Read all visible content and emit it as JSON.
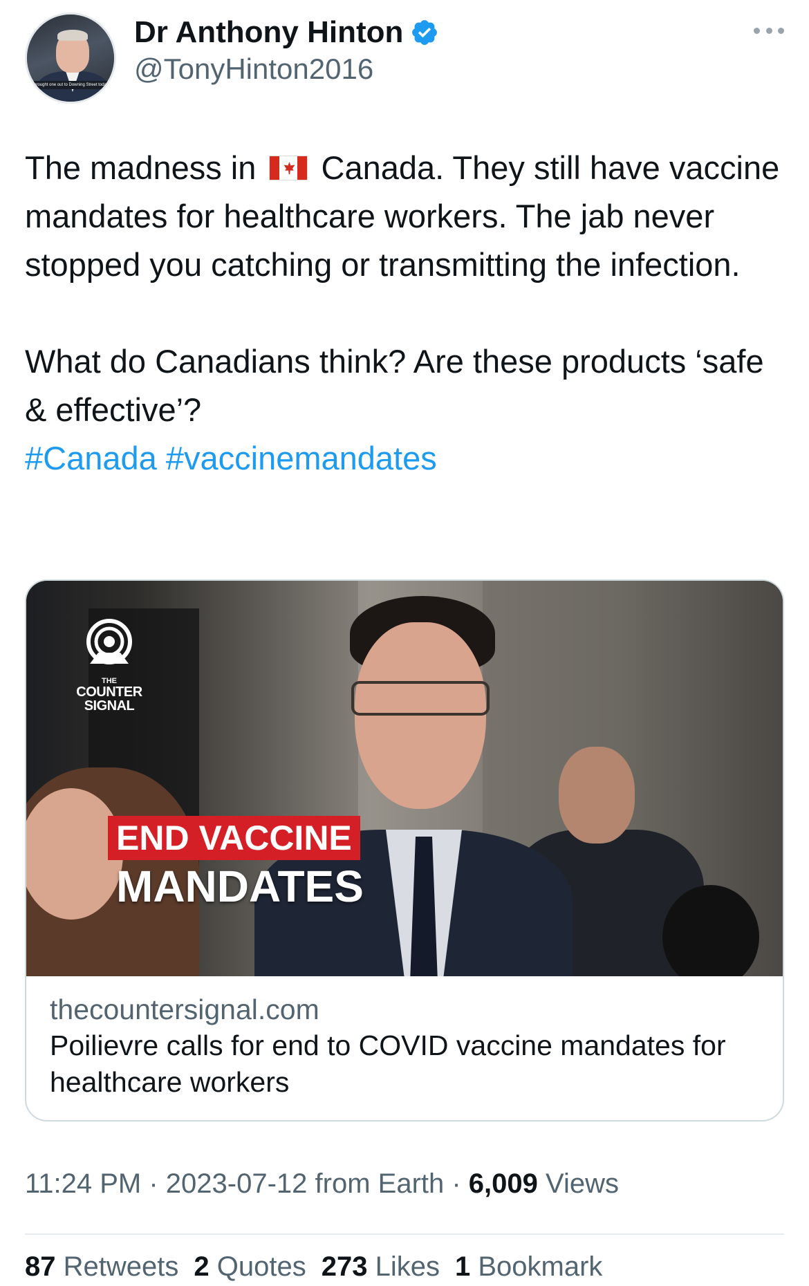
{
  "author": {
    "name": "Dr Anthony Hinton",
    "handle": "@TonyHinton2016",
    "avatar_caption": "brought one out to Downing Street today",
    "verified": true
  },
  "tweet": {
    "line1_before": "The madness in ",
    "line1_after": " Canada. They still have vaccine mandates for healthcare workers. The jab never stopped you catching or transmitting the infection.",
    "paragraph2": "What do Canadians think? Are these products ‘safe & effective’?",
    "hashtags": [
      "#Canada",
      "#vaccinemandates"
    ]
  },
  "card": {
    "logo_top": "THE",
    "logo_bottom": "COUNTER SIGNAL",
    "overlay_line1": "END VACCINE",
    "overlay_line2": "MANDATES",
    "domain": "thecountersignal.com",
    "title": "Poilievre calls for end to COVID vaccine mandates for healthcare workers"
  },
  "meta": {
    "time": "11:24 PM",
    "date": "2023-07-12",
    "source": "from Earth",
    "views_count": "6,009",
    "views_label": "Views"
  },
  "stats": {
    "retweets_count": "87",
    "retweets_label": "Retweets",
    "quotes_count": "2",
    "quotes_label": "Quotes",
    "likes_count": "273",
    "likes_label": "Likes",
    "bookmarks_count": "1",
    "bookmarks_label": "Bookmark"
  },
  "colors": {
    "link": "#1d9bf0",
    "verified": "#1d9bf0",
    "secondary_text": "#536471",
    "overlay_red": "#d41f26"
  }
}
